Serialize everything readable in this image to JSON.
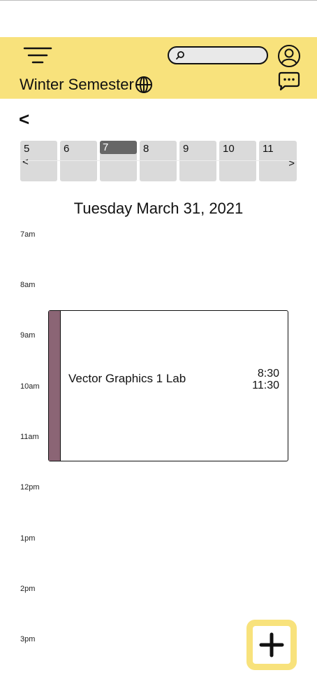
{
  "header": {
    "title": "Winter Semester",
    "search": {
      "placeholder": "",
      "value": ""
    },
    "icons": [
      "menu-icon",
      "search-icon",
      "account-icon",
      "chat-icon",
      "globe-icon"
    ],
    "background": "#f8e27c"
  },
  "nav": {
    "back_label": "<"
  },
  "week": {
    "days": [
      "5",
      "6",
      "7",
      "8",
      "9",
      "10",
      "11"
    ],
    "selected": "7",
    "prev_label": "<",
    "next_label": ">"
  },
  "date_title": "Tuesday March 31, 2021",
  "hours": [
    "7am",
    "8am",
    "9am",
    "10am",
    "11am",
    "12pm",
    "1pm",
    "2pm",
    "3pm"
  ],
  "event": {
    "title": "Vector Graphics 1 Lab",
    "start": "8:30",
    "end": "11:30",
    "color": "#8b6575"
  },
  "fab": {
    "icon": "plus-icon",
    "color": "#f8e27c"
  }
}
